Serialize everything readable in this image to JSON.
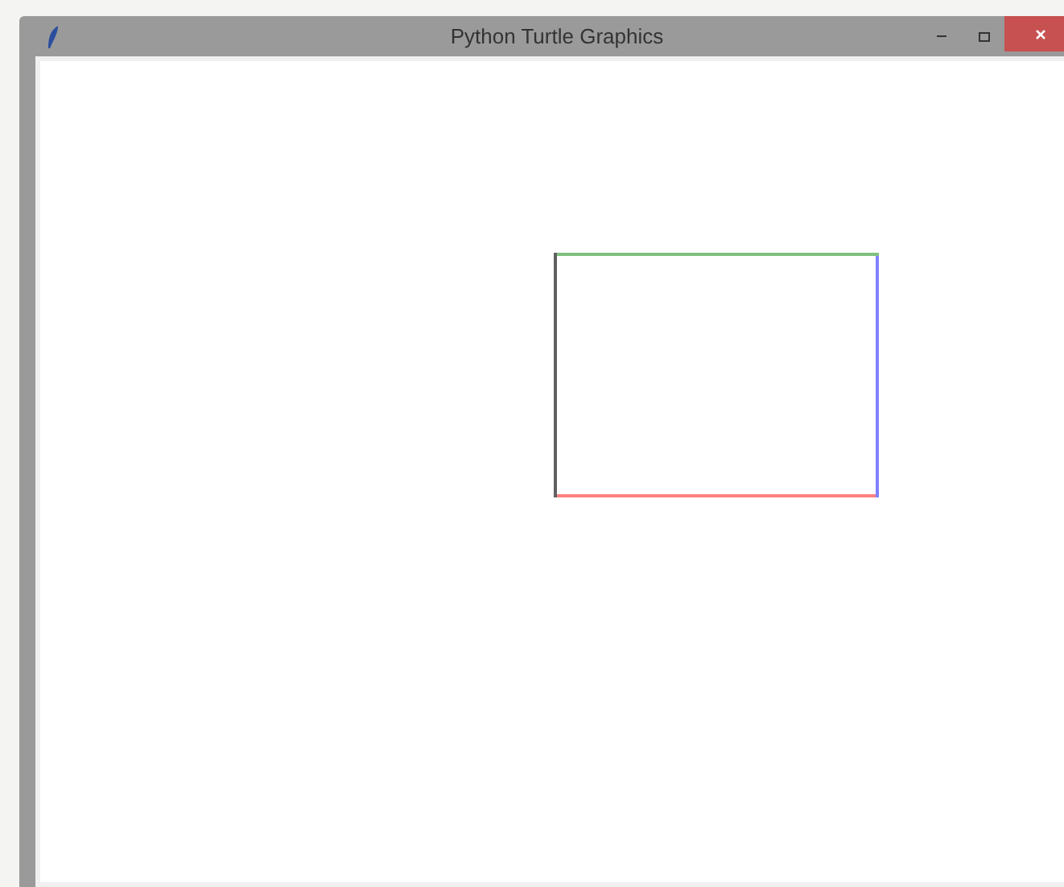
{
  "window": {
    "title": "Python Turtle Graphics"
  },
  "canvas": {
    "lines": [
      {
        "color": "#ff8080"
      },
      {
        "color": "#8080ff"
      },
      {
        "color": "#80c080"
      },
      {
        "color": "#606060"
      }
    ]
  }
}
